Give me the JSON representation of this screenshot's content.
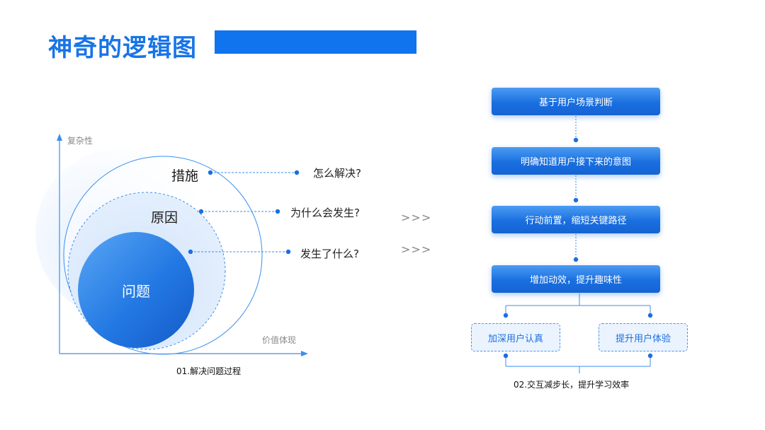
{
  "header": {
    "title": "神奇的逻辑图"
  },
  "left_diagram": {
    "axis_y_label": "复杂性",
    "axis_x_label": "价值体现",
    "layers": [
      {
        "label": "措施",
        "question": "怎么解决?"
      },
      {
        "label": "原因",
        "question": "为什么会发生?"
      },
      {
        "label": "问题",
        "question": "发生了什么?"
      }
    ],
    "caption": "01.解决问题过程"
  },
  "connector": {
    "arrows": ">>>"
  },
  "flow": {
    "steps": [
      "基于用户场景判断",
      "明确知道用户接下来的意图",
      "行动前置，缩短关键路径",
      "增加动效，提升趣味性"
    ],
    "branches": [
      "加深用户认真",
      "提升用户体验"
    ],
    "caption": "02.交互减步长，提升学习效率"
  },
  "colors": {
    "accent": "#1874e6",
    "title_bar": "#0f74ee",
    "core_dark": "#1563d3",
    "line": "#3b8ef0"
  }
}
